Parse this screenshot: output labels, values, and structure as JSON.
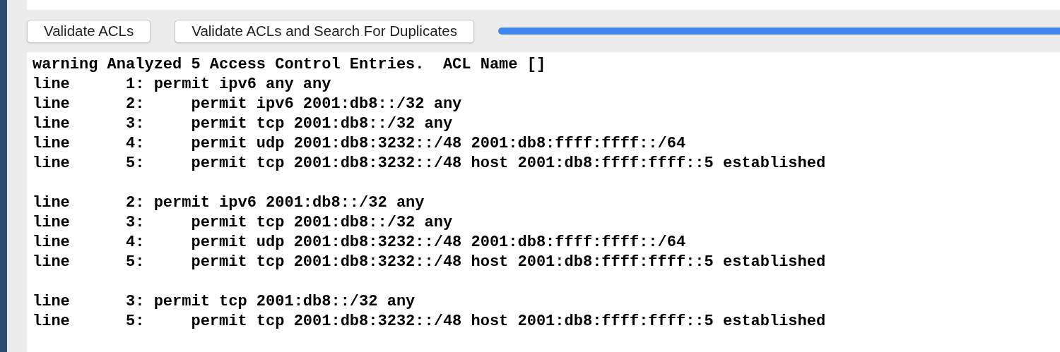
{
  "buttons": [
    {
      "label": "Validate ACLs"
    },
    {
      "label": "Validate ACLs and Search For Duplicates"
    }
  ],
  "output": {
    "groups": [
      {
        "lines": [
          "warning Analyzed 5 Access Control Entries.  ACL Name []",
          "line      1: permit ipv6 any any",
          "line      2:     permit ipv6 2001:db8::/32 any",
          "line      3:     permit tcp 2001:db8::/32 any",
          "line      4:     permit udp 2001:db8:3232::/48 2001:db8:ffff:ffff::/64",
          "line      5:     permit tcp 2001:db8:3232::/48 host 2001:db8:ffff:ffff::5 established"
        ]
      },
      {
        "lines": [
          "line      2: permit ipv6 2001:db8::/32 any",
          "line      3:     permit tcp 2001:db8::/32 any",
          "line      4:     permit udp 2001:db8:3232::/48 2001:db8:ffff:ffff::/64",
          "line      5:     permit tcp 2001:db8:3232::/48 host 2001:db8:ffff:ffff::5 established"
        ]
      },
      {
        "lines": [
          "line      3: permit tcp 2001:db8::/32 any",
          "line      5:     permit tcp 2001:db8:3232::/48 host 2001:db8:ffff:ffff::5 established"
        ]
      }
    ]
  }
}
